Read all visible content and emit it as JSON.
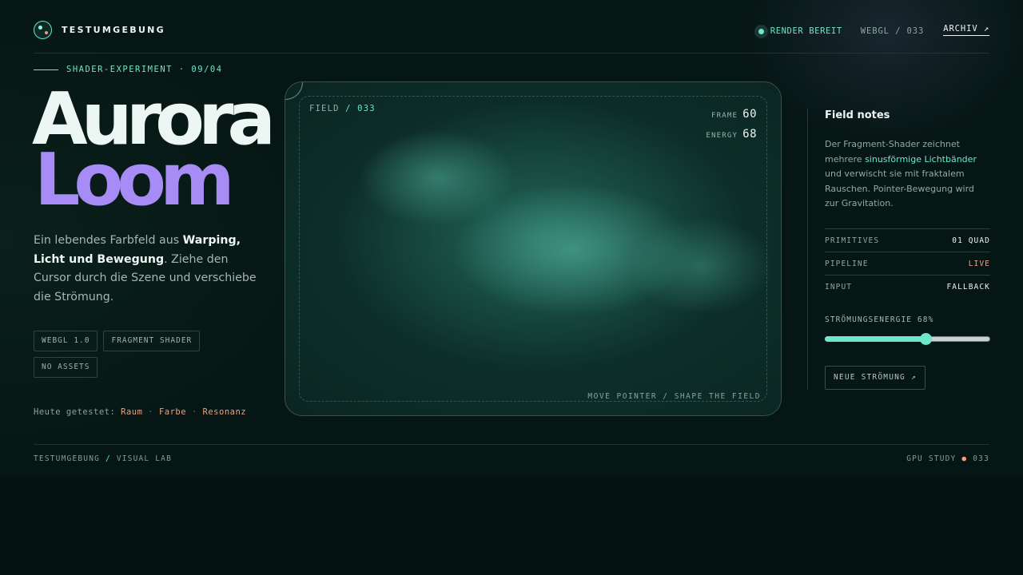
{
  "header": {
    "brand": "TESTUMGEBUNG",
    "status": "RENDER BEREIT",
    "meta": "WEBGL / 033",
    "archive_link": "ARCHIV ↗"
  },
  "hero": {
    "kicker": "SHADER-EXPERIMENT · 09/04",
    "title_line1": "Aurora",
    "title_line2": "Loom",
    "lede_pre": "Ein lebendes Farbfeld aus ",
    "lede_bold": "Warping, Licht und Bewegung",
    "lede_post": ". Ziehe den Cursor durch die Szene und verschiebe die Strömung.",
    "tags": [
      "WEBGL 1.0",
      "FRAGMENT SHADER",
      "NO ASSETS"
    ],
    "tested_label": "Heute getestet:",
    "tested_words": [
      "Raum",
      "Farbe",
      "Resonanz"
    ],
    "tested_sep": "·"
  },
  "stage": {
    "field_prefix": "FIELD",
    "field_id": "/ 033",
    "frame_label": "FRAME",
    "frame_value": "60",
    "energy_label": "ENERGY",
    "energy_value": "68",
    "hint": "MOVE POINTER / SHAPE THE FIELD"
  },
  "notes": {
    "title": "Field notes",
    "body_pre": "Der Fragment-Shader zeichnet mehrere ",
    "body_highlight": "sinusförmige Lichtbänder",
    "body_post": " und verwischt sie mit fraktalem Rauschen. Pointer-Bewegung wird zur Gravitation.",
    "specs": [
      {
        "key": "PRIMITIVES",
        "value": "01 QUAD"
      },
      {
        "key": "PIPELINE",
        "value": "LIVE"
      },
      {
        "key": "INPUT",
        "value": "FALLBACK"
      }
    ],
    "slider_label": "STRÖMUNGSENERGIE 68%",
    "slider_value_percent": 61,
    "button_label": "NEUE STRÖMUNG ↗"
  },
  "footer": {
    "left_pre": "TESTUMGEBUNG",
    "left_sep": "/",
    "left_post": "VISUAL LAB",
    "right_pre": "GPU STUDY",
    "right_dot": "●",
    "right_post": "033"
  },
  "colors": {
    "accent": "#6ee6cc",
    "violet": "#a88cf5",
    "warm": "#f0a07e",
    "background": "#061614"
  }
}
